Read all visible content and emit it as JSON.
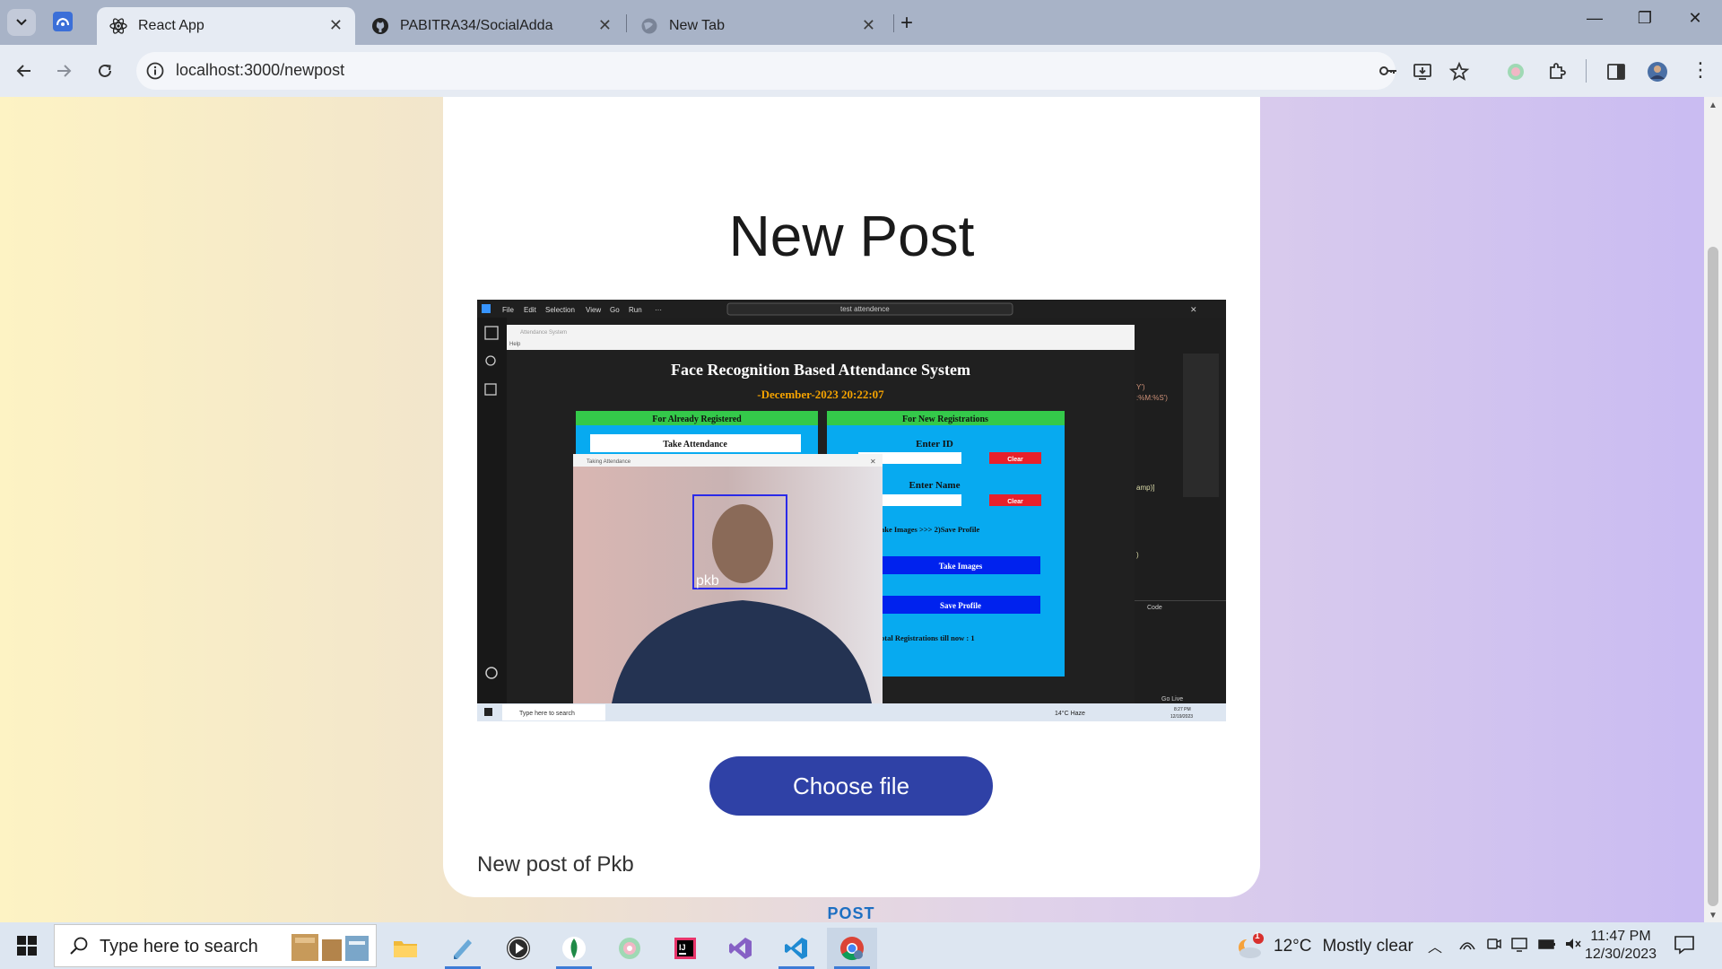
{
  "browser": {
    "tabs": [
      {
        "title": "React App",
        "active": true
      },
      {
        "title": "PABITRA34/SocialAdda",
        "active": false
      },
      {
        "title": "New Tab",
        "active": false
      }
    ],
    "url": "localhost:3000/newpost"
  },
  "page": {
    "title": "New Post",
    "choose_file_label": "Choose file",
    "caption": "New post of Pkb",
    "post_label": "POST"
  },
  "preview": {
    "menu": [
      "File",
      "Edit",
      "Selection",
      "View",
      "Go",
      "Run",
      "···"
    ],
    "search": "test attendence",
    "app_window_title": "Attendance System",
    "app_menu": "Help",
    "app_title": "Face Recognition Based Attendance System",
    "app_date": "-December-2023 20:22:07",
    "left_header": "For Already Registered",
    "take_attendance": "Take Attendance",
    "right_header": "For New Registrations",
    "enter_id": "Enter ID",
    "clear_1": "Clear",
    "enter_name": "Enter Name",
    "clear_2": "Clear",
    "steps": "ake Images  >>>  2)Save Profile",
    "take_images": "Take Images",
    "save_profile": "Save Profile",
    "total_regs": "otal Registrations till now  : 1",
    "camera_window_title": "Taking Attendance",
    "face_label": "pkb",
    "code_lines": [
      "Y')",
      ":%M:%S')",
      "amp)]",
      ")"
    ],
    "terminal_label": "Code",
    "status_right": "Go Live",
    "inner_taskbar_search": "Type here to search",
    "inner_weather": "14°C  Haze",
    "inner_time": "8:27 PM",
    "inner_date": "12/19/2023"
  },
  "taskbar": {
    "search_placeholder": "Type here to search",
    "weather_temp": "12°C",
    "weather_desc": "Mostly clear",
    "weather_badge": "1",
    "time": "11:47 PM",
    "date": "12/30/2023"
  },
  "colors": {
    "button_blue": "#2f41a6",
    "post_text": "#1d6fc2",
    "app_green": "#34c94a",
    "app_cyan": "#07aaf0",
    "app_blue_btn": "#0022ee",
    "clear_red": "#e8202a"
  }
}
